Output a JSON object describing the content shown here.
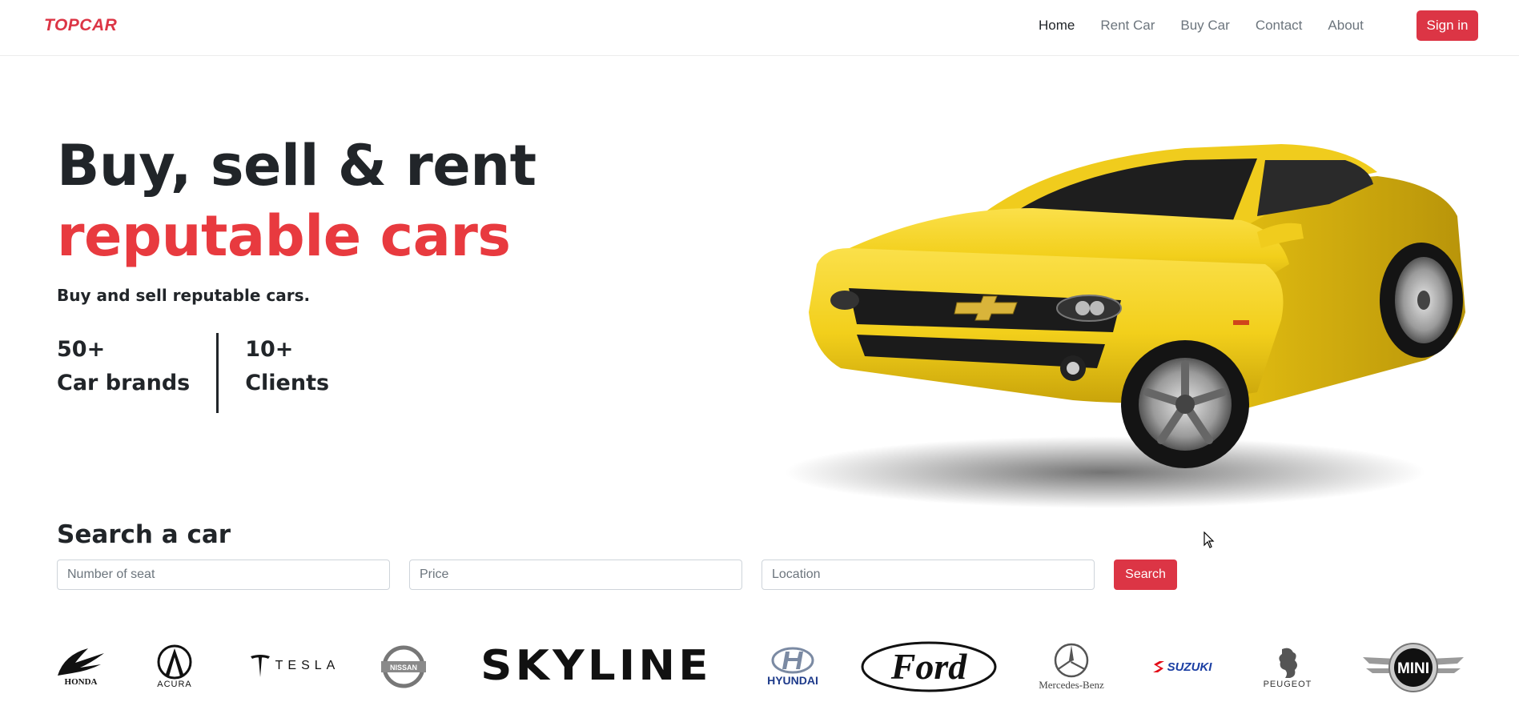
{
  "navbar": {
    "brand": "TOPCAR",
    "links": [
      {
        "label": "Home",
        "active": true
      },
      {
        "label": "Rent Car",
        "active": false
      },
      {
        "label": "Buy Car",
        "active": false
      },
      {
        "label": "Contact",
        "active": false
      },
      {
        "label": "About",
        "active": false
      }
    ],
    "signin_label": "Sign in"
  },
  "hero": {
    "title_line1": "Buy, sell & rent",
    "title_line2": "reputable cars",
    "subtitle": "Buy and sell reputable cars.",
    "stats": [
      {
        "value": "50+",
        "label": "Car brands"
      },
      {
        "value": "10+",
        "label": "Clients"
      }
    ]
  },
  "search": {
    "title": "Search a car",
    "seat_placeholder": "Number of seat",
    "price_placeholder": "Price",
    "location_placeholder": "Location",
    "button_label": "Search"
  },
  "brands": {
    "honda": "HONDA",
    "acura": "ACURA",
    "tesla": "TESLA",
    "nissan": "NISSAN",
    "skyline": "SKYLINE",
    "hyundai": "HYUNDAI",
    "ford": "Ford",
    "mercedes": "Mercedes-Benz",
    "suzuki": "SUZUKI",
    "peugeot": "PEUGEOT",
    "mini": "MINI"
  },
  "colors": {
    "accent": "#dc3545",
    "text": "#212529",
    "muted": "#6c757d",
    "car_yellow": "#f2cf1b"
  }
}
